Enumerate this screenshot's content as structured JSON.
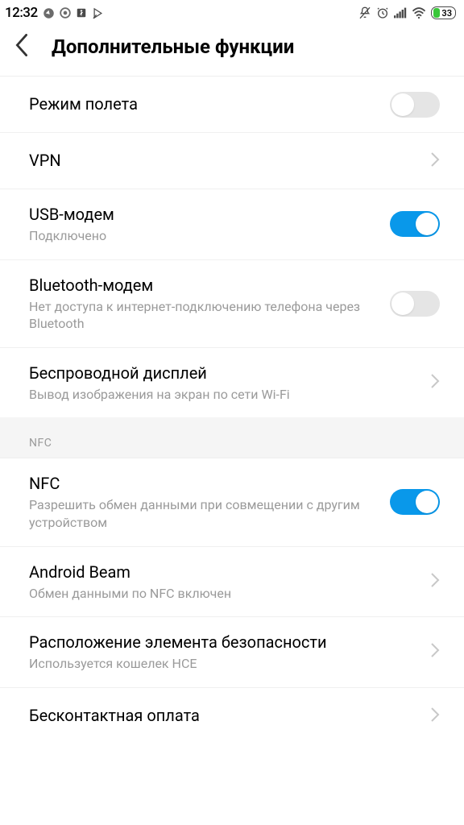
{
  "status": {
    "time": "12:32",
    "battery": "33"
  },
  "header": {
    "title": "Дополнительные функции"
  },
  "rows": {
    "airplane": {
      "title": "Режим полета"
    },
    "vpn": {
      "title": "VPN"
    },
    "usb_modem": {
      "title": "USB-модем",
      "sub": "Подключено"
    },
    "bt_modem": {
      "title": "Bluetooth-модем",
      "sub": "Нет доступа к интернет-подключению телефона через Bluetooth"
    },
    "wireless_display": {
      "title": "Беспроводной дисплей",
      "sub": "Вывод изображения на экран по сети Wi-Fi"
    },
    "nfc": {
      "title": "NFC",
      "sub": "Разрешить обмен данными при совмещении с другим устройством"
    },
    "android_beam": {
      "title": "Android Beam",
      "sub": "Обмен данными по NFC включен"
    },
    "secure_element": {
      "title": "Расположение элемента безопасности",
      "sub": "Используется кошелек HCE"
    },
    "contactless": {
      "title": "Бесконтактная оплата"
    }
  },
  "sections": {
    "nfc": "NFC"
  }
}
